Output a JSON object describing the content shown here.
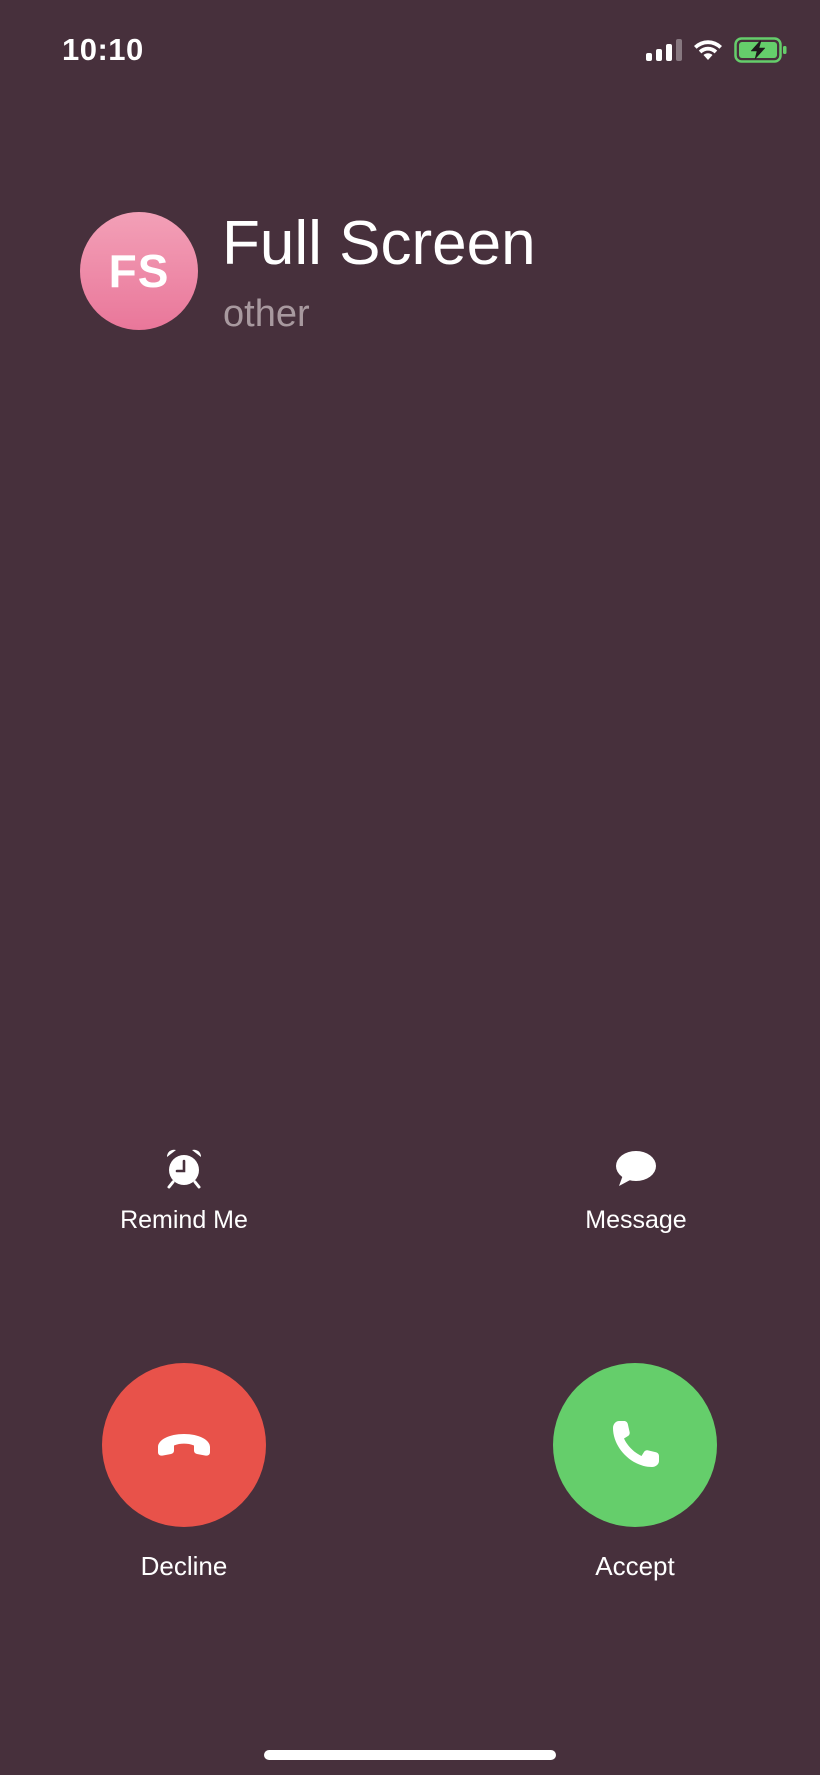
{
  "status_bar": {
    "time": "10:10",
    "signal_icon": "cellular-signal-icon",
    "wifi_icon": "wifi-icon",
    "battery_icon": "battery-charging-icon",
    "battery_color": "#65ce6b"
  },
  "caller": {
    "initials": "FS",
    "name": "Full Screen",
    "label": "other",
    "avatar_color": "#ec8aa8"
  },
  "actions": {
    "remind": {
      "label": "Remind Me",
      "icon": "alarm-clock-icon"
    },
    "message": {
      "label": "Message",
      "icon": "speech-bubble-icon"
    },
    "decline": {
      "label": "Decline",
      "icon": "phone-hangup-icon",
      "color": "#e8524a"
    },
    "accept": {
      "label": "Accept",
      "icon": "phone-icon",
      "color": "#65ce6b"
    }
  },
  "colors": {
    "background": "#47303c",
    "secondary_text": "#a8999f"
  }
}
